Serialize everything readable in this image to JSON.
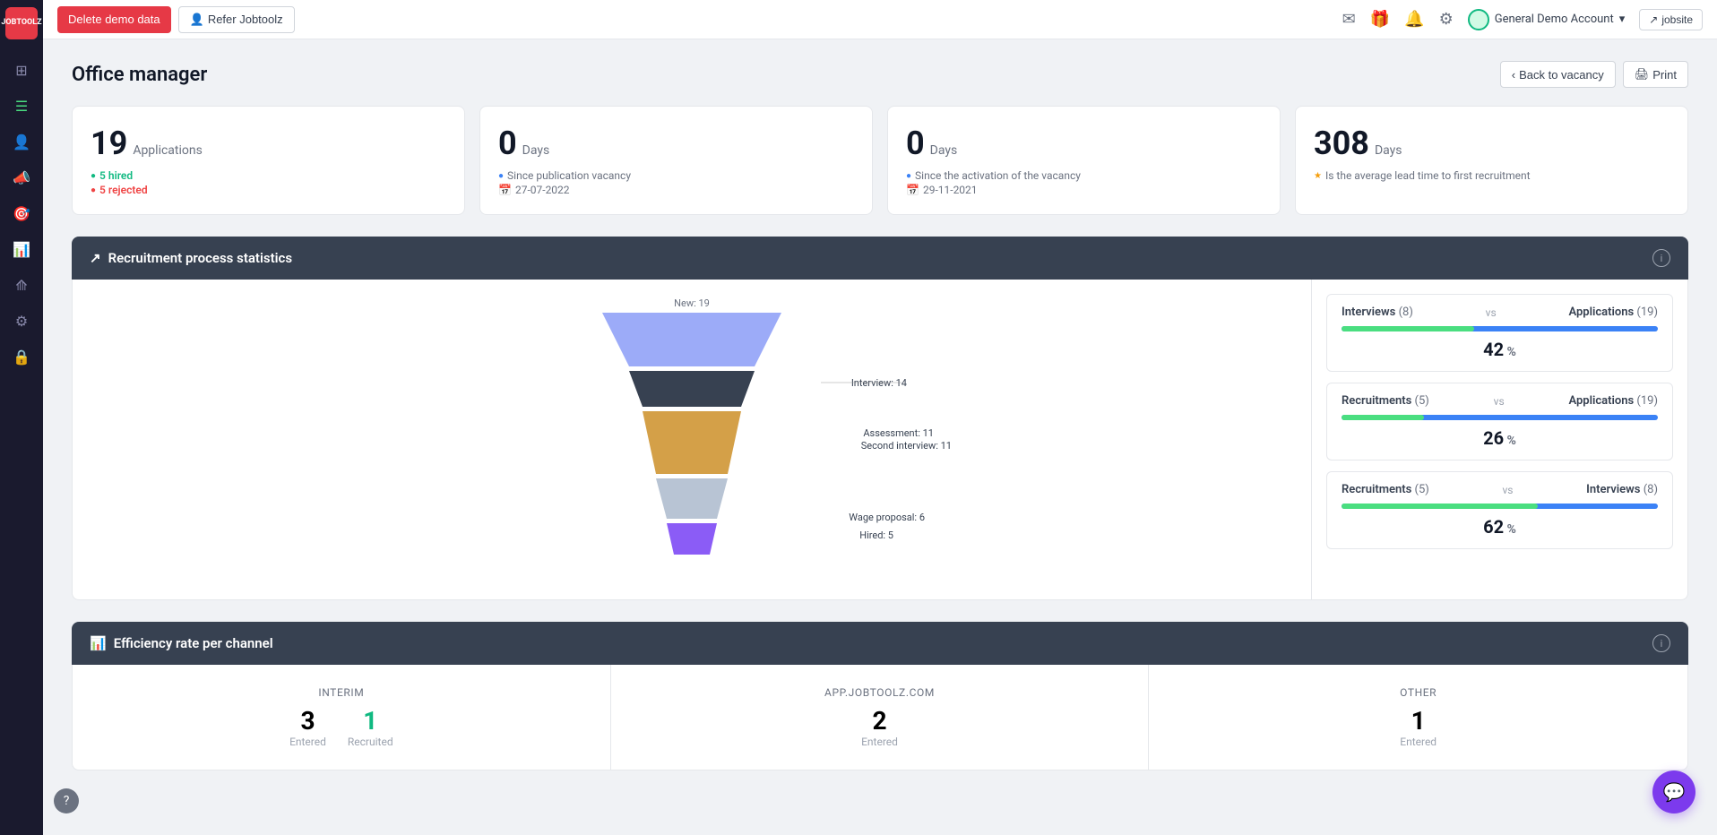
{
  "app": {
    "logo_line1": "JOB",
    "logo_line2": "TOOLZ"
  },
  "topbar": {
    "delete_btn": "Delete demo data",
    "refer_btn": "Refer Jobtoolz",
    "user_name": "General Demo Account",
    "jobsite_btn": "jobsite"
  },
  "page": {
    "title": "Office manager",
    "back_btn": "Back to vacancy",
    "print_btn": "Print"
  },
  "stats": [
    {
      "number": "19",
      "label": "Applications",
      "hired_label": "5 hired",
      "rejected_label": "5 rejected"
    },
    {
      "number": "0",
      "label": "Days",
      "sub1": "Since publication vacancy",
      "date1": "27-07-2022"
    },
    {
      "number": "0",
      "label": "Days",
      "sub1": "Since the activation of the vacancy",
      "date1": "29-11-2021"
    },
    {
      "number": "308",
      "label": "Days",
      "sub1": "Is the average lead time to first recruitment"
    }
  ],
  "recruitment": {
    "section_title": "Recruitment process statistics",
    "funnel": {
      "new_label": "New: 19",
      "interview_label": "Interview: 14",
      "assessment_label": "Assessment: 11",
      "second_interview_label": "Second interview: 11",
      "wage_label": "Wage proposal: 6",
      "hired_label": "Hired: 5"
    },
    "panels": [
      {
        "left_label": "Interviews",
        "left_count": "(8)",
        "vs": "vs",
        "right_label": "Applications",
        "right_count": "(19)",
        "percent": "42",
        "green_width": 42,
        "blue_width": 100
      },
      {
        "left_label": "Recruitments",
        "left_count": "(5)",
        "vs": "vs",
        "right_label": "Applications",
        "right_count": "(19)",
        "percent": "26",
        "green_width": 26,
        "blue_width": 100
      },
      {
        "left_label": "Recruitments",
        "left_count": "(5)",
        "vs": "vs",
        "right_label": "Interviews",
        "right_count": "(8)",
        "percent": "62",
        "green_width": 62,
        "blue_width": 100
      }
    ]
  },
  "efficiency": {
    "section_title": "Efficiency rate per channel",
    "channels": [
      {
        "name": "INTERIM",
        "entered": "3",
        "entered_label": "Entered",
        "recruited": "1",
        "recruited_label": "Recruited",
        "recruited_green": true
      },
      {
        "name": "APP.JOBTOOLZ.COM",
        "entered": "2",
        "entered_label": "Entered",
        "recruited": null
      },
      {
        "name": "OTHER",
        "entered": "1",
        "entered_label": "Entered",
        "recruited": null
      }
    ]
  }
}
